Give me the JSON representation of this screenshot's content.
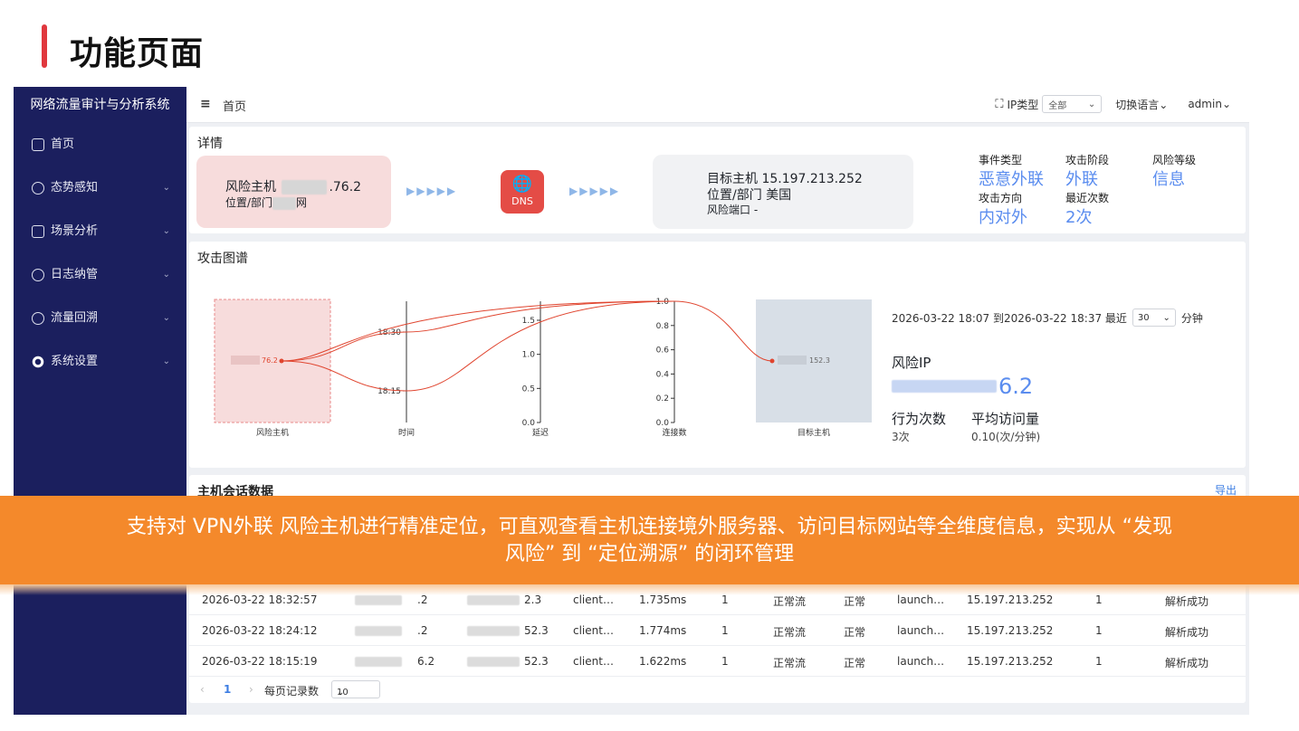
{
  "slide": {
    "title": "功能页面"
  },
  "sidebar": {
    "title": "网络流量审计与分析系统",
    "items": [
      {
        "label": "首页",
        "icon": "home-icon",
        "chevron": ""
      },
      {
        "label": "态势感知",
        "icon": "radar-icon",
        "chevron": "⌄"
      },
      {
        "label": "场景分析",
        "icon": "scene-icon",
        "chevron": "⌄"
      },
      {
        "label": "日志纳管",
        "icon": "log-icon",
        "chevron": "⌄"
      },
      {
        "label": "流量回溯",
        "icon": "clock-icon",
        "chevron": "⌄"
      },
      {
        "label": "系统设置",
        "icon": "gear-icon",
        "chevron": "⌄"
      }
    ]
  },
  "topbar": {
    "menu_icon": "≡",
    "breadcrumb": "首页",
    "expand_icon": "⛶",
    "ip_type_label": "IP类型",
    "ip_type_value": "全部",
    "language": "切换语言",
    "user": "admin"
  },
  "detail": {
    "title": "详情",
    "risk_host_label": "风险主机",
    "risk_host_ip_suffix": ".76.2",
    "risk_location_label": "位置/部门",
    "risk_location_suffix": "网",
    "arrow_glyphs": "▶▶▶▶▶",
    "dns_glyph": "🌐",
    "dns_label": "DNS",
    "target_host_label": "目标主机 15.197.213.252",
    "target_location": "位置/部门  美国",
    "target_port": "风险端口 -",
    "stats": {
      "event_type_label": "事件类型",
      "event_type_value": "恶意外联",
      "attack_stage_label": "攻击阶段",
      "attack_stage_value": "外联",
      "risk_level_label": "风险等级",
      "risk_level_value": "信息",
      "direction_label": "攻击方向",
      "direction_value": "内对外",
      "recent_count_label": "最近次数",
      "recent_count_value": "2次"
    },
    "accent_color": "#5b8def"
  },
  "graph": {
    "title": "攻击图谱",
    "axes": [
      "风险主机",
      "时间",
      "延迟",
      "连接数",
      "目标主机"
    ],
    "time_ticks": [
      "18:30",
      "18:15"
    ],
    "delay_ticks": [
      "1.5",
      "1.0",
      "0.5",
      "0.0"
    ],
    "conn_ticks": [
      "1.0",
      "0.8",
      "0.6",
      "0.4",
      "0.2",
      "0.0"
    ],
    "source_node_label": "76.2",
    "target_node_label": "152.3",
    "range_text": "2026-03-22 18:07 到2026-03-22 18:37 最近",
    "range_select": "30",
    "range_unit": "分钟",
    "risk_ip_label": "风险IP",
    "risk_ip_suffix": "6.2",
    "behavior_label": "行为次数",
    "behavior_value": "3次",
    "avg_label": "平均访问量",
    "avg_value": "0.10(次/分钟)",
    "link_color": "#e0452f"
  },
  "sessions": {
    "title": "主机会话数据",
    "export": "导出",
    "rows": [
      {
        "time": "2026-03-22 18:32:57",
        "src": ".2",
        "dst": "2.3",
        "client": "client…",
        "latency": "1.735ms",
        "count": "1",
        "flow": "正常流",
        "status": "正常",
        "app": "launch…",
        "target": "15.197.213.252",
        "num": "1",
        "result": "解析成功"
      },
      {
        "time": "2026-03-22 18:24:12",
        "src": ".2",
        "dst": "52.3",
        "client": "client…",
        "latency": "1.774ms",
        "count": "1",
        "flow": "正常流",
        "status": "正常",
        "app": "launch…",
        "target": "15.197.213.252",
        "num": "1",
        "result": "解析成功"
      },
      {
        "time": "2026-03-22 18:15:19",
        "src": "6.2",
        "dst": "52.3",
        "client": "client…",
        "latency": "1.622ms",
        "count": "1",
        "flow": "正常流",
        "status": "正常",
        "app": "launch…",
        "target": "15.197.213.252",
        "num": "1",
        "result": "解析成功"
      }
    ],
    "pager": {
      "prev": "‹",
      "page": "1",
      "next": "›",
      "per_page_label": "每页记录数",
      "per_page_value": "10"
    }
  },
  "banner": {
    "line1": "支持对 VPN外联 风险主机进行精准定位，可直观查看主机连接境外服务器、访问目标网站等全维度信息，实现从 “发现",
    "line2": "风险” 到 “定位溯源” 的闭环管理"
  }
}
